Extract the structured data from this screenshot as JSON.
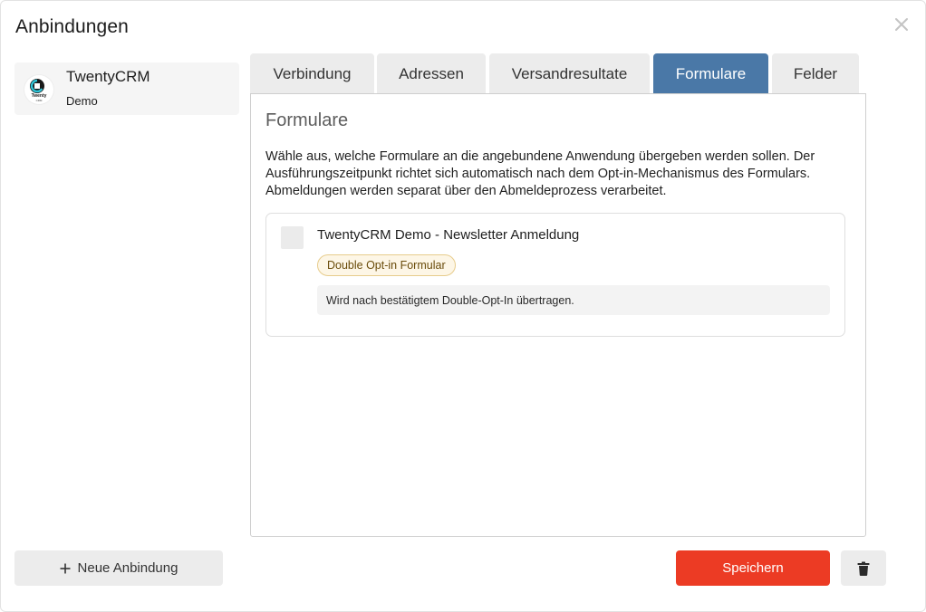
{
  "dialog": {
    "title": "Anbindungen",
    "close_icon": "close-icon"
  },
  "sidebar": {
    "items": [
      {
        "name": "TwentyCRM",
        "subtitle": "Demo",
        "logo_icon": "twentycrm-logo-icon",
        "logo_text": "Twenty CRM"
      }
    ]
  },
  "tabs": [
    {
      "label": "Verbindung",
      "active": false
    },
    {
      "label": "Adressen",
      "active": false
    },
    {
      "label": "Versandresultate",
      "active": false
    },
    {
      "label": "Formulare",
      "active": true
    },
    {
      "label": "Felder",
      "active": false
    }
  ],
  "panel": {
    "title": "Formulare",
    "description": "Wähle aus, welche Formulare an die angebundene Anwendung übergeben werden sollen. Der Ausführungszeitpunkt richtet sich automatisch nach dem Opt-in-Mechanismus des Formulars. Abmeldungen werden separat über den Abmeldeprozess verarbeitet.",
    "forms": [
      {
        "checked": false,
        "name": "TwentyCRM Demo - Newsletter Anmeldung",
        "badge": "Double Opt-in Formular",
        "note": "Wird nach bestätigtem Double-Opt-In übertragen."
      }
    ]
  },
  "footer": {
    "new_label": "Neue Anbindung",
    "new_icon": "plus-icon",
    "save_label": "Speichern",
    "delete_icon": "trash-icon"
  },
  "colors": {
    "active_tab": "#4a78a7",
    "save_button": "#ec3b24",
    "badge_border": "#e7cc8c",
    "badge_bg": "#fdf6e6"
  }
}
